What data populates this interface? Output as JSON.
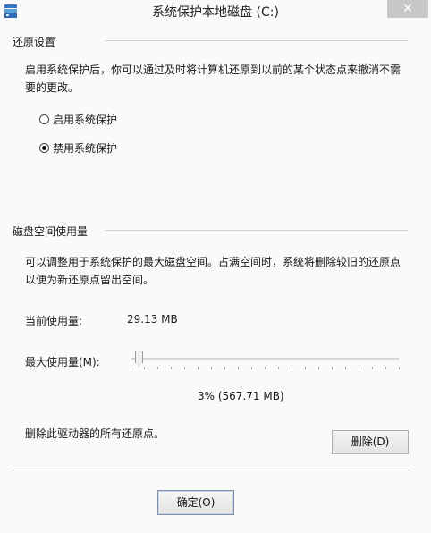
{
  "window": {
    "title": "系统保护本地磁盘 (C:)",
    "close_glyph": "✕"
  },
  "restore": {
    "section_title": "还原设置",
    "description_line1": "启用系统保护后，你可以通过及时将计算机还原到以前的某个状态点来撤消不需",
    "description_line2": "要的更改。",
    "options": [
      {
        "label": "启用系统保护",
        "checked": false
      },
      {
        "label": "禁用系统保护",
        "checked": true
      }
    ]
  },
  "disk": {
    "section_title": "磁盘空间使用量",
    "description_line1": "可以调整用于系统保护的最大磁盘空间。占满空间时，系统将删除较旧的还原点",
    "description_line2": "以便为新还原点留出空间。",
    "current_usage_label": "当前使用量:",
    "current_usage_value": "29.13 MB",
    "max_usage_label": "最大使用量(M):",
    "max_usage_percent": 3,
    "max_usage_readout": "3% (567.71 MB)",
    "delete_text": "删除此驱动器的所有还原点。",
    "delete_button": "删除(D)"
  },
  "footer": {
    "ok_button": "确定(O)"
  }
}
